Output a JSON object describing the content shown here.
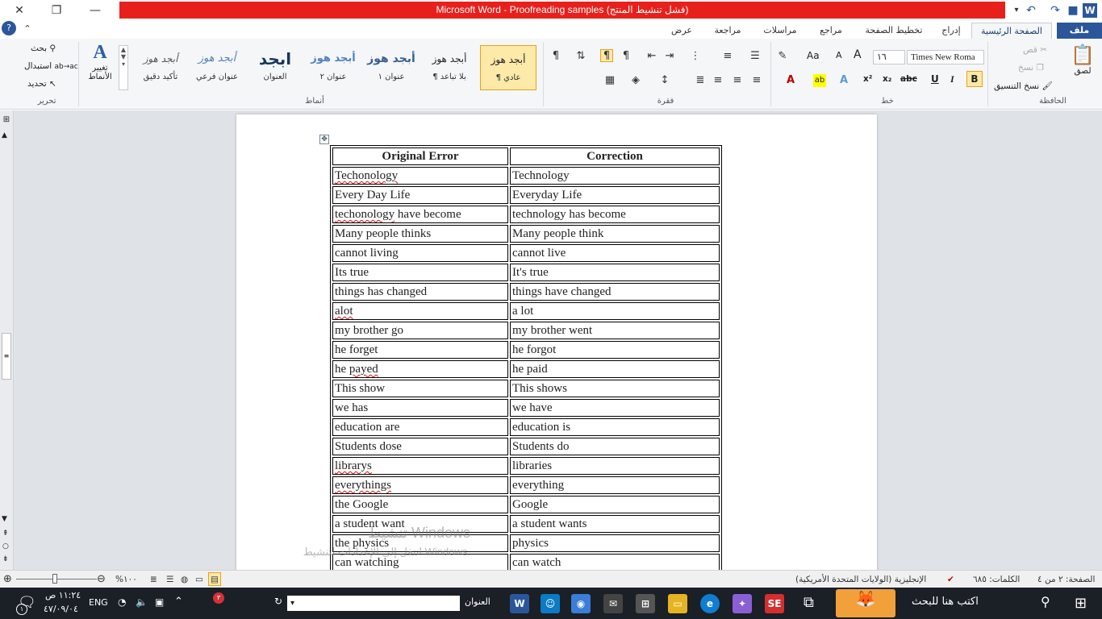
{
  "window": {
    "title": "Microsoft Word - Proofreading samples (فشل تنشيط المنتج)",
    "controls": {
      "close": "✕",
      "restore": "❐",
      "minimize": "—",
      "help": "?"
    }
  },
  "quick_access": {
    "app_badge": "W"
  },
  "tabs": {
    "file": "ملف",
    "home": "الصفحة الرئيسية",
    "insert": "إدراج",
    "layout": "تخطيط الصفحة",
    "references": "مراجع",
    "mailings": "مراسلات",
    "review": "مراجعة",
    "view": "عرض"
  },
  "ribbon": {
    "clipboard": {
      "paste": "لصق",
      "cut": "قص",
      "copy": "نسخ",
      "format_painter": "نسخ التنسيق",
      "label": "الحافظة"
    },
    "font": {
      "name": "Times New Roma",
      "size": "١٦",
      "bold": "B",
      "italic": "I",
      "underline": "U",
      "strike": "abc",
      "sub": "x₂",
      "sup": "x²",
      "aa": "Aa",
      "grow": "A",
      "shrink": "A",
      "label": "خط"
    },
    "paragraph": {
      "label": "فقرة",
      "pilcrow": "¶"
    },
    "styles": {
      "label": "أنماط",
      "items": [
        {
          "sample": "أبجد هوز",
          "name": "¶ عادي"
        },
        {
          "sample": "أبجد هوز",
          "name": "¶ بلا تباعد"
        },
        {
          "sample": "أبجد هوز",
          "name": "عنوان ١"
        },
        {
          "sample": "أبجد هوز",
          "name": "عنوان ٢"
        },
        {
          "sample": "ابجد",
          "name": "العنوان"
        },
        {
          "sample": "أبجد هوز",
          "name": "عنوان فرعي"
        },
        {
          "sample": "أبجد هوز",
          "name": "تأكيد دقيق"
        }
      ],
      "change_styles": "تغيير الأنماط"
    },
    "editing": {
      "find": "بحث",
      "replace": "استبدال",
      "select": "تحديد",
      "label": "تحرير"
    }
  },
  "document": {
    "headers": [
      "Original Error",
      "Correction"
    ],
    "rows": [
      [
        "Techonology",
        "Technology"
      ],
      [
        "Every Day Life",
        "Everyday Life"
      ],
      [
        "techonology have become",
        "technology has become"
      ],
      [
        "Many people thinks",
        "Many people think"
      ],
      [
        "cannot living",
        "cannot live"
      ],
      [
        "Its true",
        "It's true"
      ],
      [
        "things has changed",
        "things have changed"
      ],
      [
        "alot",
        "a lot"
      ],
      [
        "my brother go",
        "my brother went"
      ],
      [
        "he forget",
        "he forgot"
      ],
      [
        "he payed",
        "he paid"
      ],
      [
        "This  show",
        "This  shows"
      ],
      [
        "we has",
        "we have"
      ],
      [
        "education are",
        "education is"
      ],
      [
        "Students dose",
        "Students do"
      ],
      [
        "librarys",
        "libraries"
      ],
      [
        "everythings",
        "everything"
      ],
      [
        "the Google",
        "Google"
      ],
      [
        "a student want",
        "a student wants"
      ],
      [
        "the physics",
        "physics"
      ],
      [
        "can watching",
        "can watch"
      ]
    ],
    "misspelled": [
      "Techonology",
      "techonology",
      "alot",
      "payed",
      "librarys",
      "everythings"
    ]
  },
  "activation_watermark": {
    "line1": "تنشيط Windows",
    "line2": "انتقل إلى الإعدادات لتنشيط Windows."
  },
  "statusbar": {
    "page": "الصفحة: ٢ من ٤",
    "words": "الكلمات: ٦٨٥",
    "language": "الإنجليزية (الولايات المتحدة الأمريكية)",
    "zoom": "%١٠٠"
  },
  "taskbar": {
    "search_placeholder": "اكتب هنا للبحث",
    "address_label": "العنوان",
    "language": "ENG",
    "time": "١١:٢٤ ص",
    "date": "٤٧/٠٩/٠٤",
    "notification_count": "٣",
    "action_badge": "١"
  }
}
